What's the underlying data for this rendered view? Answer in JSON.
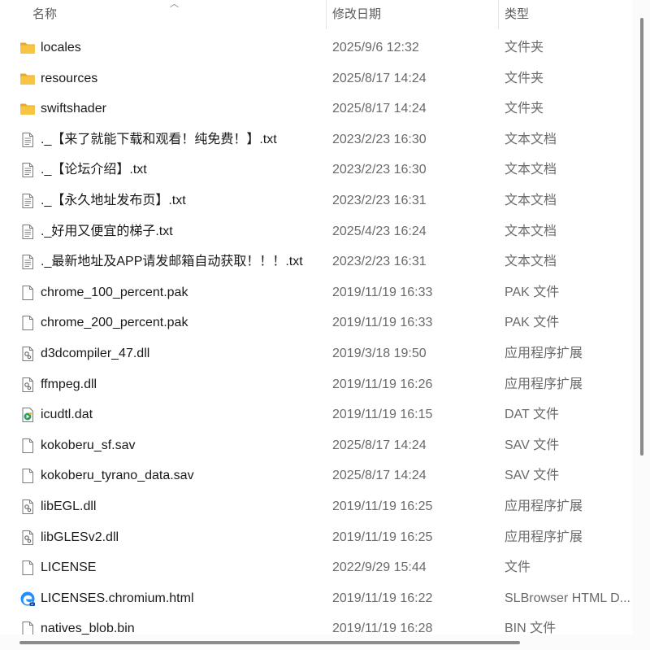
{
  "columns": {
    "name": "名称",
    "date": "修改日期",
    "type": "类型"
  },
  "colors": {
    "folder": "#f8c443",
    "folder_tab": "#e8a92a",
    "edge_blue": "#1e90ff"
  },
  "files": [
    {
      "name": "locales",
      "date": "2025/9/6 12:32",
      "type": "文件夹",
      "icon": "folder"
    },
    {
      "name": "resources",
      "date": "2025/8/17 14:24",
      "type": "文件夹",
      "icon": "folder"
    },
    {
      "name": "swiftshader",
      "date": "2025/8/17 14:24",
      "type": "文件夹",
      "icon": "folder"
    },
    {
      "name": "._【来了就能下载和观看！纯免费！】.txt",
      "date": "2023/2/23 16:30",
      "type": "文本文档",
      "icon": "text"
    },
    {
      "name": "._【论坛介绍】.txt",
      "date": "2023/2/23 16:30",
      "type": "文本文档",
      "icon": "text"
    },
    {
      "name": "._【永久地址发布页】.txt",
      "date": "2023/2/23 16:31",
      "type": "文本文档",
      "icon": "text"
    },
    {
      "name": "._好用又便宜的梯子.txt",
      "date": "2025/4/23 16:24",
      "type": "文本文档",
      "icon": "text"
    },
    {
      "name": "._最新地址及APP请发邮箱自动获取！！！.txt",
      "date": "2023/2/23 16:31",
      "type": "文本文档",
      "icon": "text"
    },
    {
      "name": "chrome_100_percent.pak",
      "date": "2019/11/19 16:33",
      "type": "PAK 文件",
      "icon": "blank"
    },
    {
      "name": "chrome_200_percent.pak",
      "date": "2019/11/19 16:33",
      "type": "PAK 文件",
      "icon": "blank"
    },
    {
      "name": "d3dcompiler_47.dll",
      "date": "2019/3/18 19:50",
      "type": "应用程序扩展",
      "icon": "dll"
    },
    {
      "name": "ffmpeg.dll",
      "date": "2019/11/19 16:26",
      "type": "应用程序扩展",
      "icon": "dll"
    },
    {
      "name": "icudtl.dat",
      "date": "2019/11/19 16:15",
      "type": "DAT 文件",
      "icon": "media"
    },
    {
      "name": "kokoberu_sf.sav",
      "date": "2025/8/17 14:24",
      "type": "SAV 文件",
      "icon": "blank"
    },
    {
      "name": "kokoberu_tyrano_data.sav",
      "date": "2025/8/17 14:24",
      "type": "SAV 文件",
      "icon": "blank"
    },
    {
      "name": "libEGL.dll",
      "date": "2019/11/19 16:25",
      "type": "应用程序扩展",
      "icon": "dll"
    },
    {
      "name": "libGLESv2.dll",
      "date": "2019/11/19 16:25",
      "type": "应用程序扩展",
      "icon": "dll"
    },
    {
      "name": "LICENSE",
      "date": "2022/9/29 15:44",
      "type": "文件",
      "icon": "blank"
    },
    {
      "name": "LICENSES.chromium.html",
      "date": "2019/11/19 16:22",
      "type": "SLBrowser HTML D...",
      "icon": "browser"
    },
    {
      "name": "natives_blob.bin",
      "date": "2019/11/19 16:28",
      "type": "BIN 文件",
      "icon": "blank"
    }
  ]
}
